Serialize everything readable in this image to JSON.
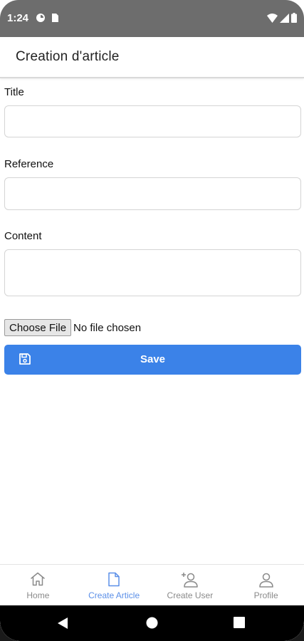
{
  "status_bar": {
    "time": "1:24"
  },
  "header": {
    "title": "Creation d'article"
  },
  "form": {
    "title_label": "Title",
    "title_value": "",
    "reference_label": "Reference",
    "reference_value": "",
    "content_label": "Content",
    "content_value": ""
  },
  "file_input": {
    "button_label": "Choose File",
    "status": "No file chosen"
  },
  "save": {
    "label": "Save",
    "icon": "save-icon",
    "color": "#3b82e8"
  },
  "bottom_nav": {
    "items": [
      {
        "label": "Home",
        "icon": "home-icon",
        "active": false
      },
      {
        "label": "Create Article",
        "icon": "document-icon",
        "active": true
      },
      {
        "label": "Create User",
        "icon": "add-user-icon",
        "active": false
      },
      {
        "label": "Profile",
        "icon": "person-icon",
        "active": false
      }
    ],
    "active_color": "#5b8fe8"
  }
}
